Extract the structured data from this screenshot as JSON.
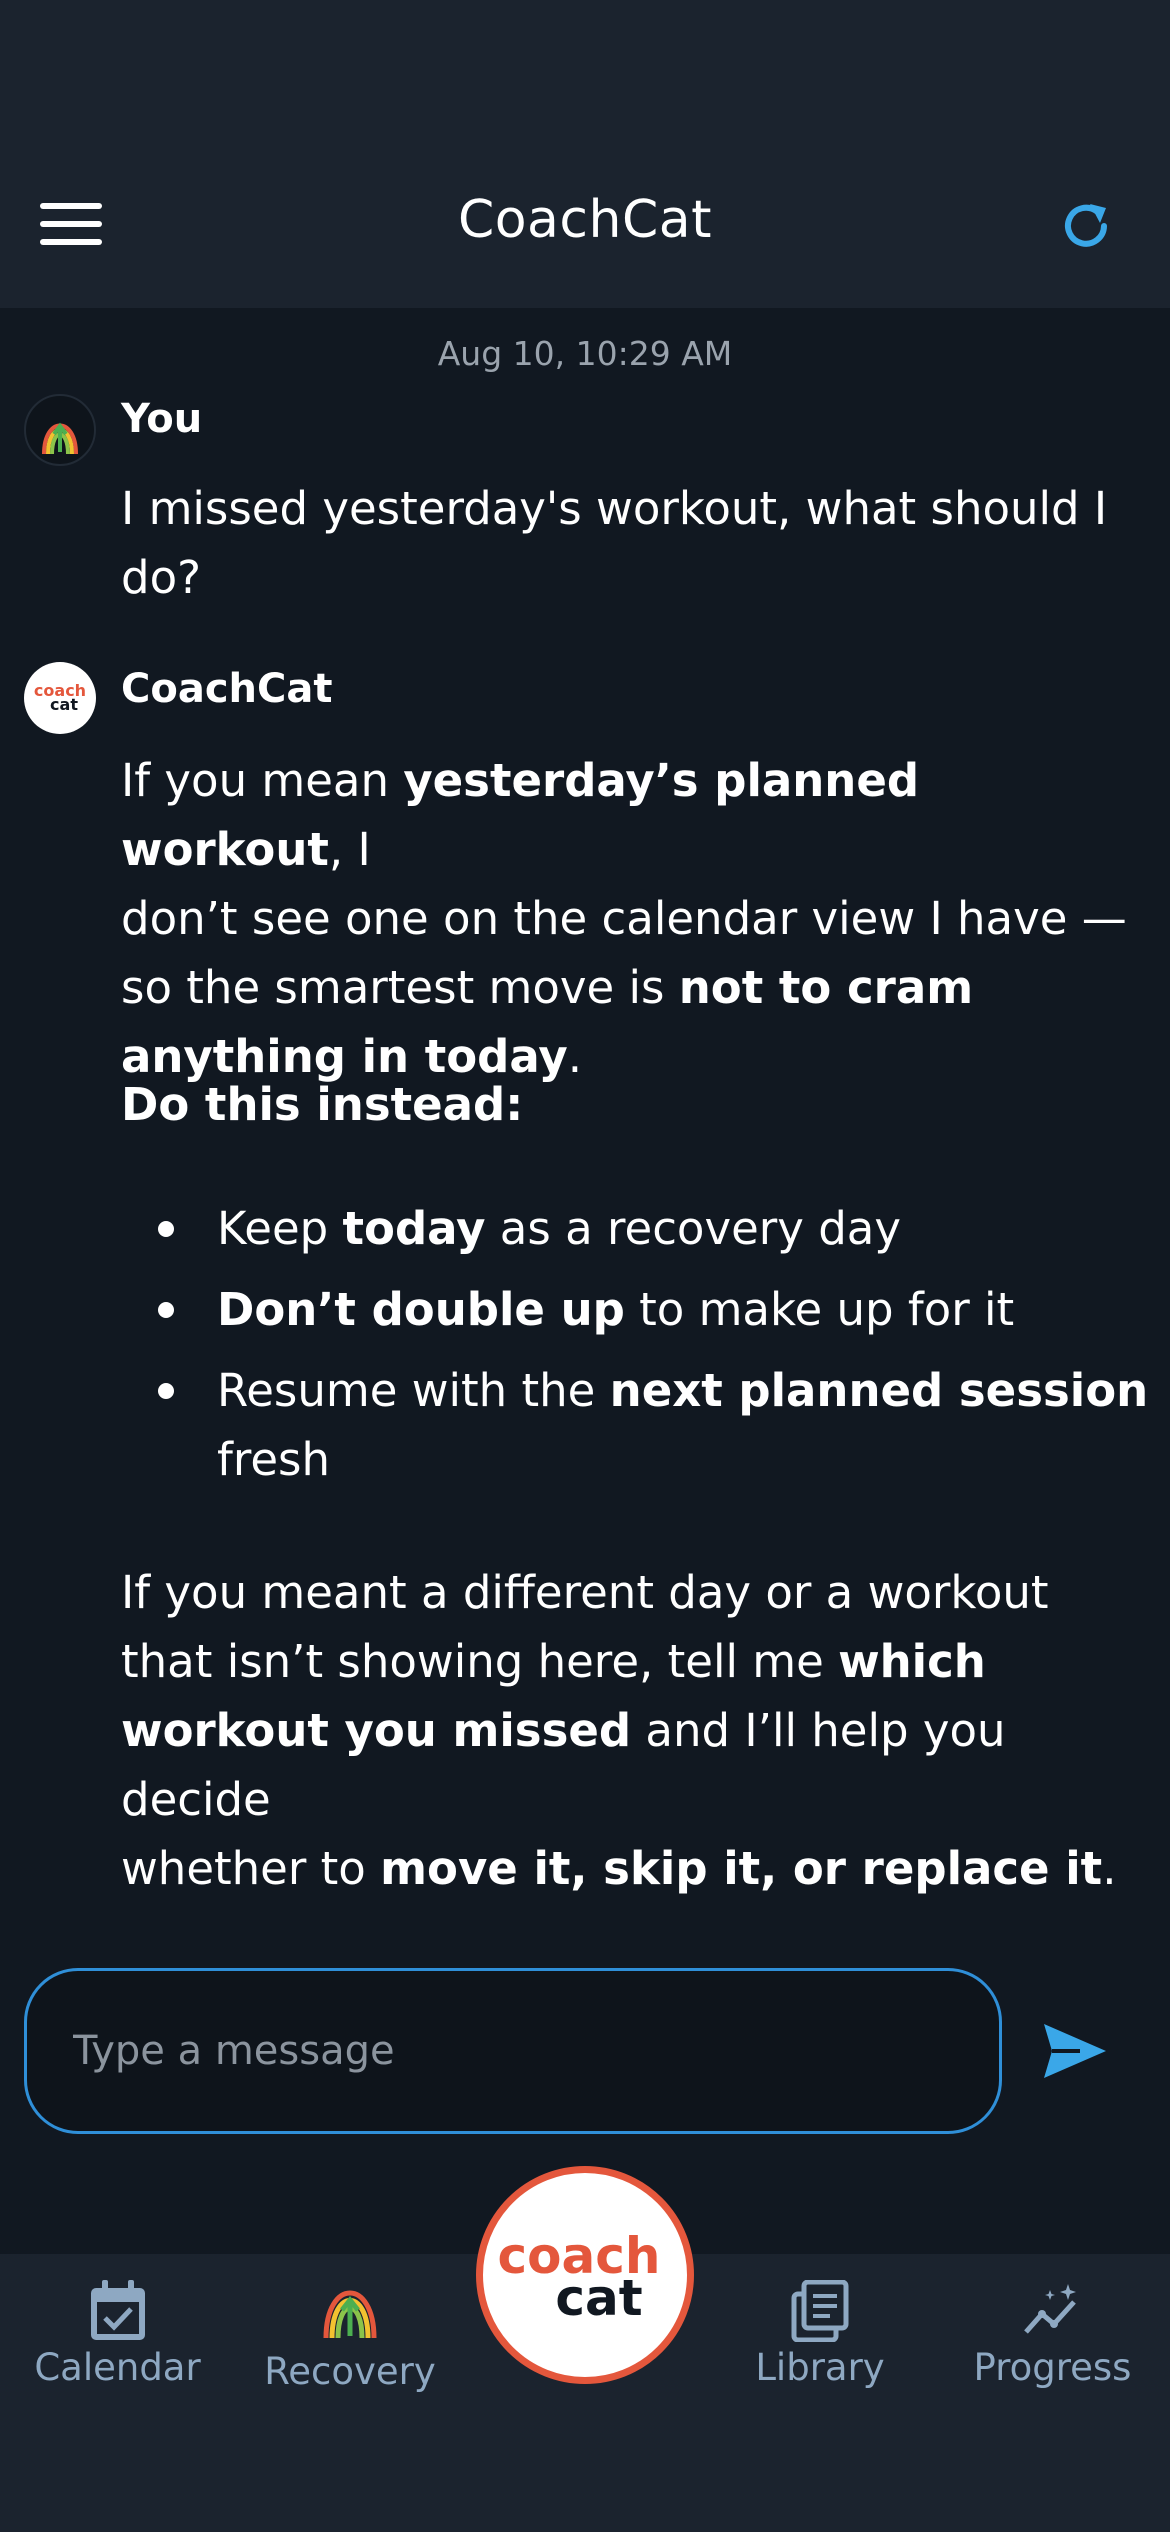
{
  "header": {
    "title": "CoachCat"
  },
  "chat": {
    "timestamp": "Aug 10, 10:29 AM",
    "user_name": "You",
    "user_message": [
      "I missed yesterday's workout, what should I",
      "do?"
    ],
    "bot_name": "CoachCat",
    "p1": {
      "l1a": "If you mean ",
      "l1b": "yesterday’s planned workout",
      "l1c": ", I",
      "l2": "don’t see one on the calendar view I have —",
      "l3a": "so the smartest move is ",
      "l3b": "not to cram",
      "l4a": "anything in today",
      "l4b": "."
    },
    "heading": "Do this instead:",
    "bullets": {
      "b1a": "Keep ",
      "b1b": "today",
      "b1c": " as a recovery day",
      "b2a": "Don’t double up",
      "b2b": " to make up for it",
      "b3a": "Resume with the ",
      "b3b": "next planned session",
      "b3c": "fresh"
    },
    "p2": {
      "l1": "If you meant a different day or a workout",
      "l2a": "that isn’t showing here, tell me ",
      "l2b": "which",
      "l3a": "workout you missed",
      "l3b": " and I’ll help you decide",
      "l4a": "whether to ",
      "l4b": "move it, skip it, or replace it",
      "l4c": "."
    }
  },
  "composer": {
    "placeholder": "Type a message"
  },
  "nav": {
    "calendar": "Calendar",
    "recovery": "Recovery",
    "library": "Library",
    "progress": "Progress"
  },
  "logo": {
    "line1": "coach",
    "line2": "cat"
  },
  "colors": {
    "accent": "#3aa7e8",
    "brand": "#e4573c",
    "background": "#111821",
    "header": "#1b232e"
  },
  "icons": {
    "menu": "hamburger-menu-icon",
    "refresh": "refresh-icon",
    "send": "send-icon",
    "calendar": "calendar-check-icon",
    "recovery": "recovery-arch-icon",
    "library": "library-icon",
    "progress": "progress-chart-icon"
  }
}
